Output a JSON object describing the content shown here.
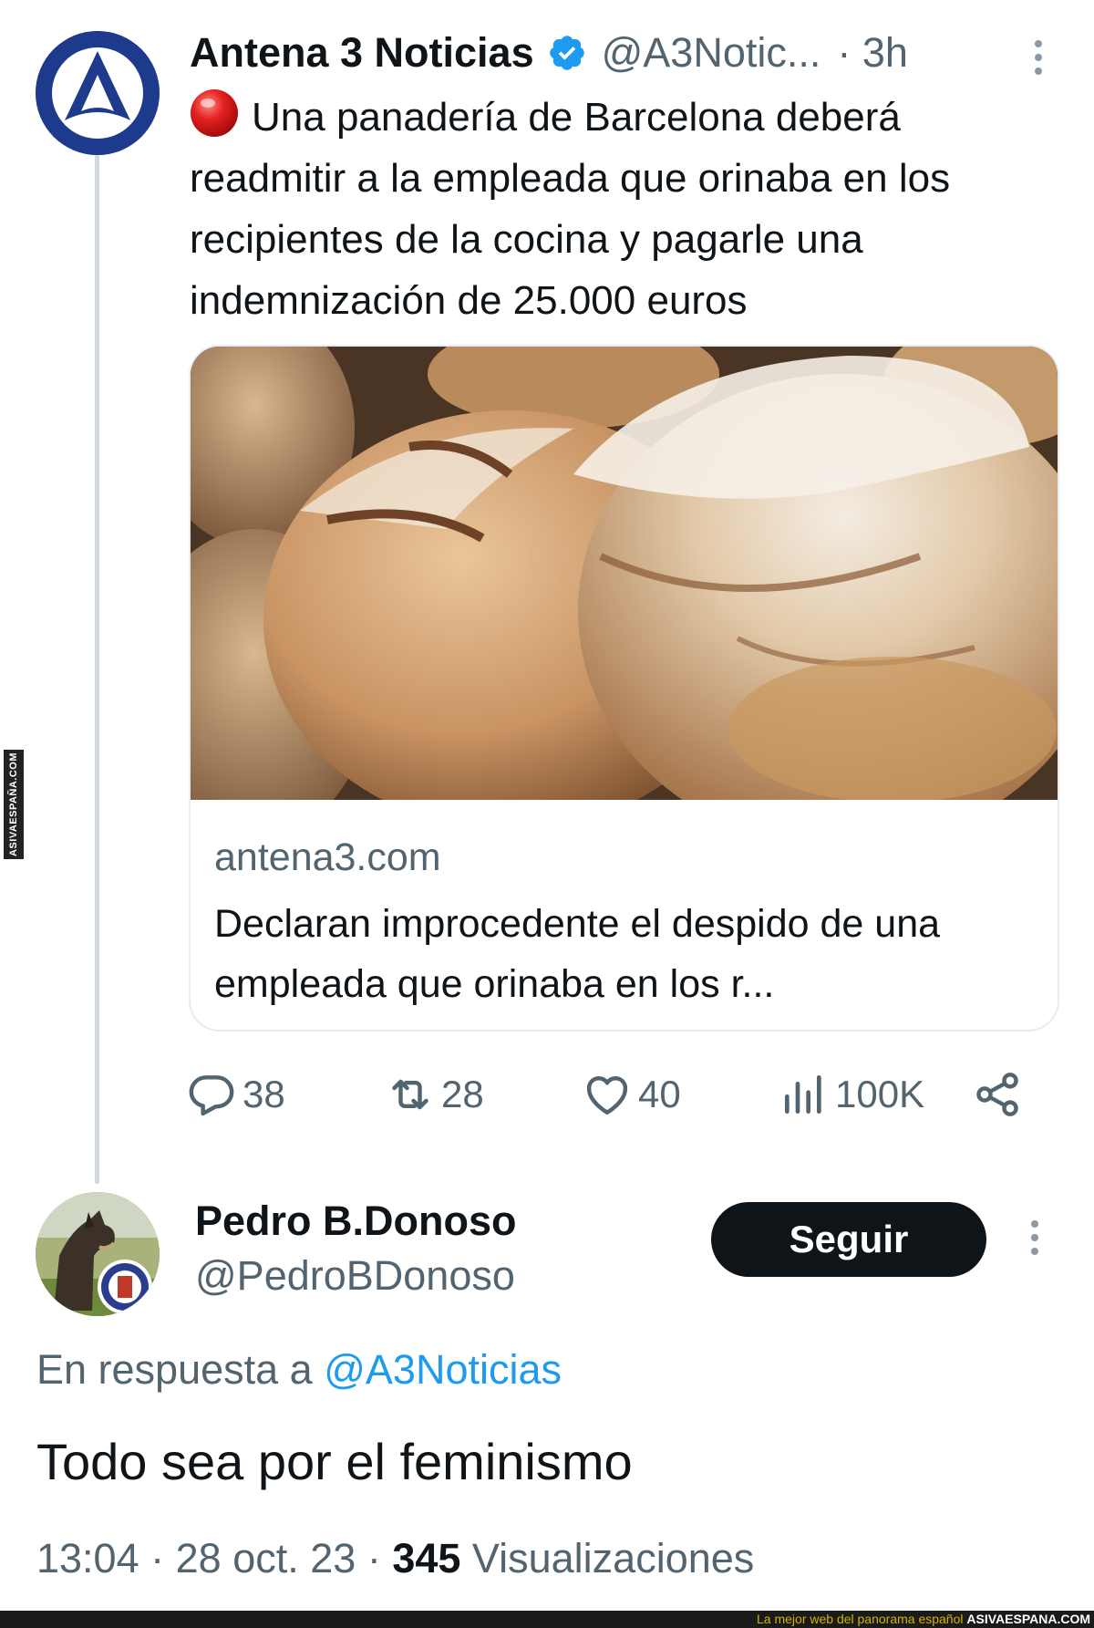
{
  "tweet": {
    "author_name": "Antena 3 Noticias",
    "author_handle": "@A3Notic...",
    "time": "· 3h",
    "text": "Una panadería de Barcelona deberá readmitir a la empleada que orinaba en los recipientes de la cocina y pagarle una indemnización de 25.000 euros",
    "card": {
      "domain": "antena3.com",
      "title": "Declaran improcedente el despido de una empleada que orinaba en los r..."
    },
    "actions": {
      "replies": "38",
      "retweets": "28",
      "likes": "40",
      "views": "100K"
    }
  },
  "reply": {
    "author_name": "Pedro B.Donoso",
    "author_handle": "@PedroBDonoso",
    "follow_label": "Seguir",
    "in_reply_prefix": "En respuesta a",
    "in_reply_mention": "@A3Noticias",
    "text": "Todo sea por el feminismo",
    "time": "13:04",
    "date": "28 oct. 23",
    "views_count": "345",
    "views_label": "Visualizaciones"
  },
  "watermark": {
    "side_text": "ASIVAESPAÑA.COM",
    "footer_text": "La mejor web del panorama español",
    "footer_brand": "ASIVAESPANA.COM"
  },
  "icons": [
    "antena3-logo",
    "verified-badge-icon",
    "red-circle-emoji",
    "more-options-icon",
    "reply-icon",
    "retweet-icon",
    "like-icon",
    "views-icon",
    "share-icon"
  ],
  "colors": {
    "verified_blue": "#1d9bf0",
    "mention_blue": "#1d9bf0",
    "secondary_text": "#536471",
    "follow_button_bg": "#0f1419",
    "antena3_blue": "#1e3a8c"
  }
}
